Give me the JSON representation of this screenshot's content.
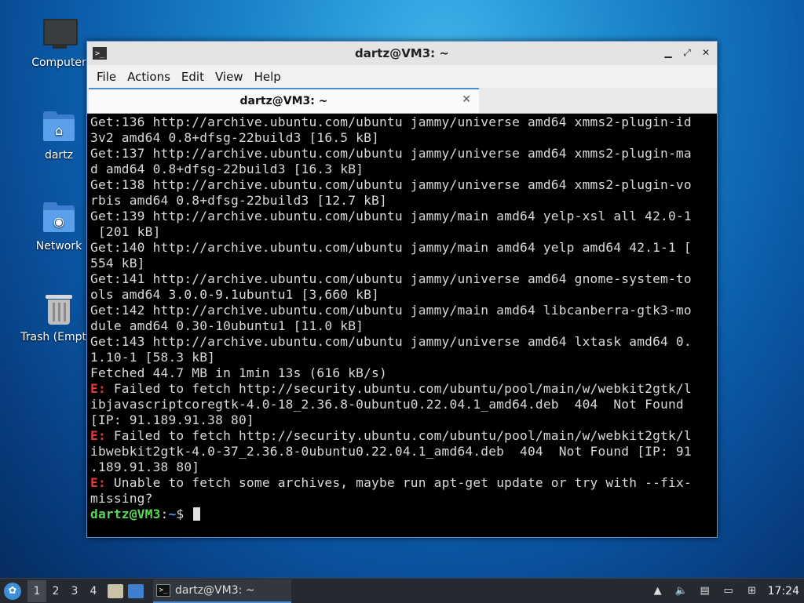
{
  "desktop": {
    "icons": [
      {
        "label": "Computer"
      },
      {
        "label": "dartz"
      },
      {
        "label": "Network"
      },
      {
        "label": "Trash (Empty)"
      }
    ]
  },
  "window": {
    "title": "dartz@VM3: ~",
    "menu": [
      "File",
      "Actions",
      "Edit",
      "View",
      "Help"
    ],
    "tab_label": "dartz@VM3: ~",
    "terminal_lines": [
      {
        "type": "normal",
        "text": "Get:136 http://archive.ubuntu.com/ubuntu jammy/universe amd64 xmms2-plugin-id"
      },
      {
        "type": "normal",
        "text": "3v2 amd64 0.8+dfsg-22build3 [16.5 kB]"
      },
      {
        "type": "normal",
        "text": "Get:137 http://archive.ubuntu.com/ubuntu jammy/universe amd64 xmms2-plugin-ma"
      },
      {
        "type": "normal",
        "text": "d amd64 0.8+dfsg-22build3 [16.3 kB]"
      },
      {
        "type": "normal",
        "text": "Get:138 http://archive.ubuntu.com/ubuntu jammy/universe amd64 xmms2-plugin-vo"
      },
      {
        "type": "normal",
        "text": "rbis amd64 0.8+dfsg-22build3 [12.7 kB]"
      },
      {
        "type": "normal",
        "text": "Get:139 http://archive.ubuntu.com/ubuntu jammy/main amd64 yelp-xsl all 42.0-1"
      },
      {
        "type": "normal",
        "text": " [201 kB]"
      },
      {
        "type": "normal",
        "text": "Get:140 http://archive.ubuntu.com/ubuntu jammy/main amd64 yelp amd64 42.1-1 ["
      },
      {
        "type": "normal",
        "text": "554 kB]"
      },
      {
        "type": "normal",
        "text": "Get:141 http://archive.ubuntu.com/ubuntu jammy/universe amd64 gnome-system-to"
      },
      {
        "type": "normal",
        "text": "ols amd64 3.0.0-9.1ubuntu1 [3,660 kB]"
      },
      {
        "type": "normal",
        "text": "Get:142 http://archive.ubuntu.com/ubuntu jammy/main amd64 libcanberra-gtk3-mo"
      },
      {
        "type": "normal",
        "text": "dule amd64 0.30-10ubuntu1 [11.0 kB]"
      },
      {
        "type": "normal",
        "text": "Get:143 http://archive.ubuntu.com/ubuntu jammy/universe amd64 lxtask amd64 0."
      },
      {
        "type": "normal",
        "text": "1.10-1 [58.3 kB]"
      },
      {
        "type": "normal",
        "text": "Fetched 44.7 MB in 1min 13s (616 kB/s)"
      },
      {
        "type": "error",
        "prefix": "E:",
        "text": " Failed to fetch http://security.ubuntu.com/ubuntu/pool/main/w/webkit2gtk/l"
      },
      {
        "type": "normal",
        "text": "ibjavascriptcoregtk-4.0-18_2.36.8-0ubuntu0.22.04.1_amd64.deb  404  Not Found"
      },
      {
        "type": "normal",
        "text": "[IP: 91.189.91.38 80]"
      },
      {
        "type": "error",
        "prefix": "E:",
        "text": " Failed to fetch http://security.ubuntu.com/ubuntu/pool/main/w/webkit2gtk/l"
      },
      {
        "type": "normal",
        "text": "ibwebkit2gtk-4.0-37_2.36.8-0ubuntu0.22.04.1_amd64.deb  404  Not Found [IP: 91"
      },
      {
        "type": "normal",
        "text": ".189.91.38 80]"
      },
      {
        "type": "error",
        "prefix": "E:",
        "text": " Unable to fetch some archives, maybe run apt-get update or try with --fix-"
      },
      {
        "type": "normal",
        "text": "missing?"
      }
    ],
    "prompt": {
      "user": "dartz@VM3",
      "sep": ":",
      "path": "~",
      "symbol": "$ "
    }
  },
  "taskbar": {
    "workspaces": [
      "1",
      "2",
      "3",
      "4"
    ],
    "active_workspace": "1",
    "task_label": "dartz@VM3: ~",
    "clock": "17:24"
  },
  "colors": {
    "error": "#e23b3b",
    "prompt_user": "#5ad85a",
    "prompt_path": "#5b8ff0",
    "accent": "#4a8bd8"
  }
}
